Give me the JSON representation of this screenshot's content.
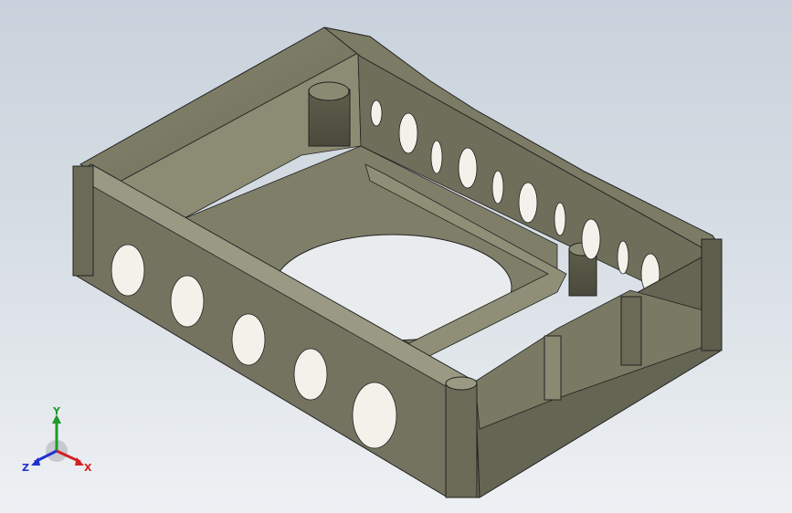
{
  "scene": {
    "background_top": "#c9d2dc",
    "background_bottom": "#eef1f4",
    "model_color": "#74745f",
    "edge_color": "#1e1e16",
    "hole_color": "#f2f2ea"
  },
  "triad": {
    "x_label": "X",
    "y_label": "Y",
    "z_label": "Z",
    "x_color": "#d42020",
    "y_color": "#1f9a2a",
    "z_color": "#2030d0"
  }
}
